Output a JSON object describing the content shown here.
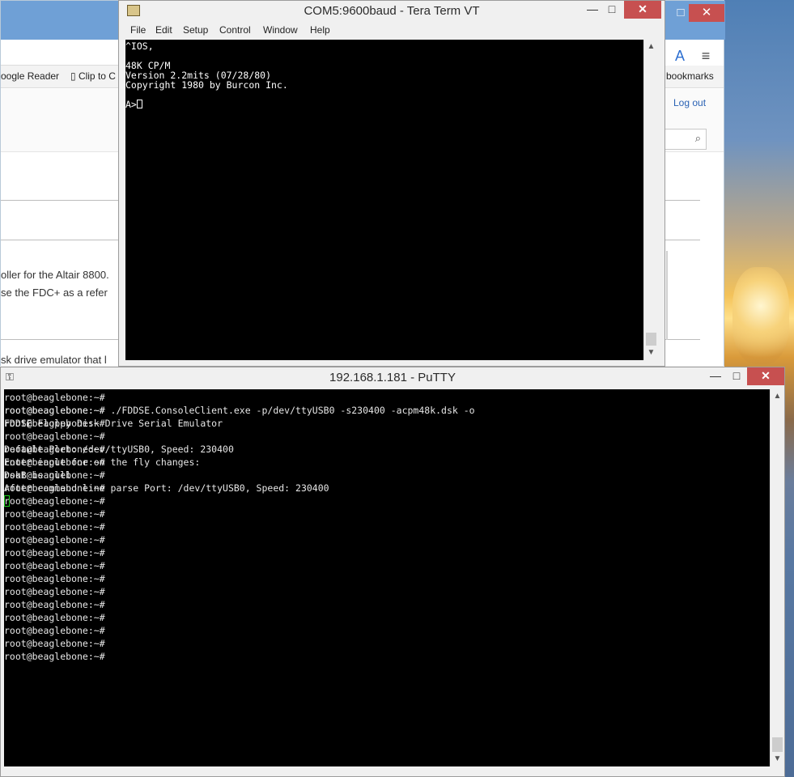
{
  "browser": {
    "bookmarks": [
      "oogle Reader",
      "Clip to C",
      "bookmarks"
    ],
    "logout_label": "Log out",
    "body_lines": [
      "oller for the Altair 8800.",
      "se the FDC+ as a refer",
      "sk drive emulator that l"
    ]
  },
  "teraterm": {
    "title": "COM5:9600baud - Tera Term VT",
    "menu": [
      "File",
      "Edit",
      "Setup",
      "Control",
      "Window",
      "Help"
    ],
    "lines": [
      "^IOS,",
      "",
      "48K CP/M",
      "Version 2.2mits (07/28/80)",
      "Copyright 1980 by Burcon Inc.",
      "",
      "A>"
    ]
  },
  "putty": {
    "title": "192.168.1.181 - PuTTY",
    "prompt_lines": [
      "root@beaglebone:~#",
      "root@beaglebone:~#",
      "root@beaglebone:~#",
      "root@beaglebone:~#",
      "root@beaglebone:~#",
      "root@beaglebone:~#",
      "root@beaglebone:~#",
      "root@beaglebone:~#",
      "root@beaglebone:~#",
      "root@beaglebone:~#",
      "root@beaglebone:~#",
      "root@beaglebone:~#",
      "root@beaglebone:~#",
      "root@beaglebone:~#",
      "root@beaglebone:~#",
      "root@beaglebone:~#",
      "root@beaglebone:~#",
      "root@beaglebone:~#",
      "root@beaglebone:~#",
      "root@beaglebone:~#",
      "root@beaglebone:~#"
    ],
    "output_lines": [
      "root@beaglebone:~# ./FDDSE.ConsoleClient.exe -p/dev/ttyUSB0 -s230400 -acpm48k.dsk -o",
      "FDDSE Floppy Disk Drive Serial Emulator",
      "",
      "Default Port: /dev/ttyUSB0, Speed: 230400",
      "Enter input for on the fly changes:",
      "DskB is null",
      "After command line parse Port: /dev/ttyUSB0, Speed: 230400"
    ]
  },
  "window_controls": {
    "minimize": "—",
    "maximize": "□",
    "close": "✕"
  },
  "colors": {
    "terminal_bg": "#000000",
    "close_red": "#c75050",
    "cursor_green": "#1fd01f"
  }
}
